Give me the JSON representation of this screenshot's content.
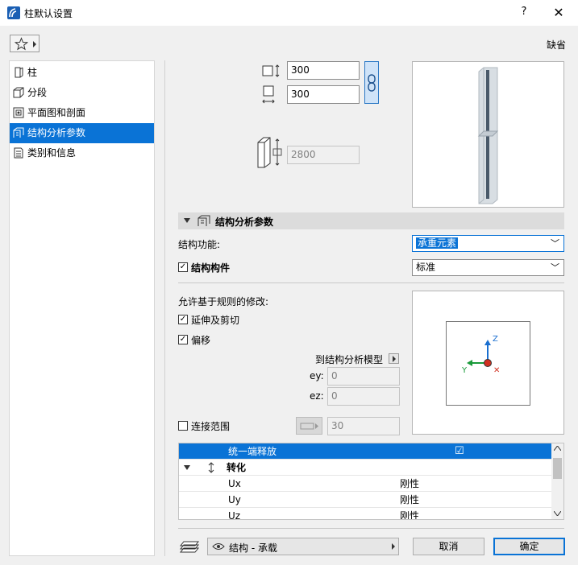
{
  "window": {
    "title": "柱默认设置",
    "help": "?",
    "close": "✕"
  },
  "toolbar": {
    "default_label": "缺省"
  },
  "sidebar": {
    "items": [
      {
        "label": "柱",
        "icon": "column-icon"
      },
      {
        "label": "分段",
        "icon": "segment-icon"
      },
      {
        "label": "平面图和剖面",
        "icon": "floorplan-section-icon"
      },
      {
        "label": "结构分析参数",
        "icon": "structural-analysis-icon",
        "active": true
      },
      {
        "label": "类别和信息",
        "icon": "category-info-icon"
      }
    ]
  },
  "dimensions": {
    "width": "300",
    "depth": "300",
    "height": "2800"
  },
  "section": {
    "title": "结构分析参数"
  },
  "structural": {
    "function_label": "结构功能:",
    "function_value": "承重元素",
    "member_label": "结构构件",
    "member_checked": true,
    "member_value": "标准"
  },
  "rules": {
    "title": "允许基于规则的修改:",
    "extend_trim": "延伸及剪切",
    "extend_checked": true,
    "offset": "偏移",
    "offset_checked": true,
    "to_model": "到结构分析模型",
    "ey_label": "ey:",
    "ey_value": "0",
    "ez_label": "ez:",
    "ez_value": "0",
    "connection_range": "连接范围",
    "connection_checked": false,
    "connection_value": "30"
  },
  "axes": {
    "z": "Z",
    "y": "Y",
    "x": "✕"
  },
  "grid_table": {
    "rows": [
      {
        "name": "统一端释放",
        "value": "☑",
        "selected": true
      },
      {
        "name": "转化",
        "header": true
      },
      {
        "name": "Ux",
        "value": "刚性"
      },
      {
        "name": "Uy",
        "value": "刚性"
      },
      {
        "name": "Uz",
        "value": "刚性"
      }
    ]
  },
  "footer": {
    "layer": "结构 - 承载",
    "cancel": "取消",
    "ok": "确定"
  },
  "colors": {
    "accent": "#0a73d6"
  }
}
